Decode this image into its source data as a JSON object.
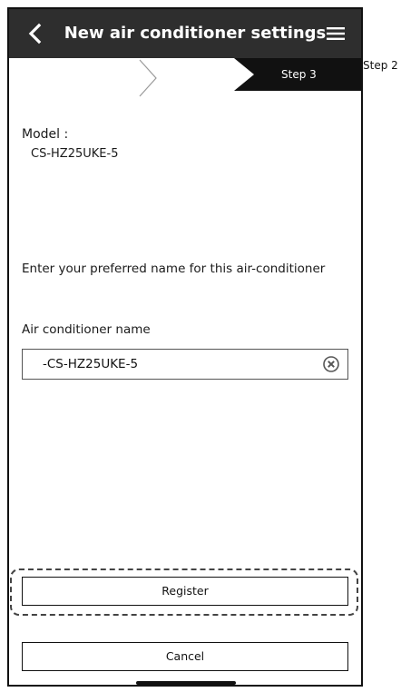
{
  "header": {
    "title": "New air conditioner settings",
    "back_icon": "chevron-left-icon",
    "menu_icon": "hamburger-menu-icon"
  },
  "steps": {
    "current_label": "Step 3",
    "next_label": "Step 2"
  },
  "model": {
    "label": "Model :",
    "value": "CS-HZ25UKE-5"
  },
  "prompt": "Enter your preferred name for this air-conditioner",
  "name_field": {
    "label": "Air conditioner name",
    "value": "-CS-HZ25UKE-5",
    "clear_icon": "clear-circle-x-icon"
  },
  "buttons": {
    "register": "Register",
    "cancel": "Cancel"
  },
  "colors": {
    "header_bg": "#2e2e2e",
    "step_active_bg": "#111111",
    "text": "#1a1a1a"
  }
}
